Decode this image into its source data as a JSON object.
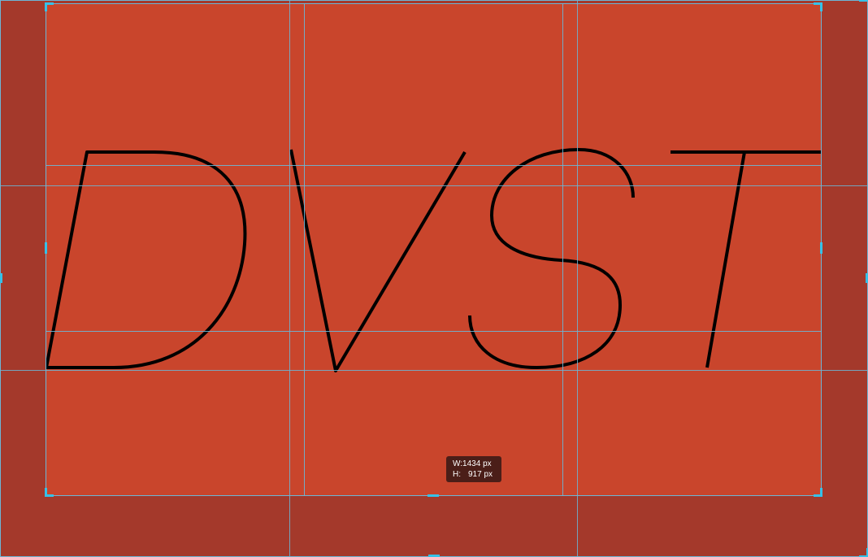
{
  "canvas": {
    "text": "DVST",
    "background_color": "#c9452c",
    "outside_color": "#a4392b",
    "guide_color": "#6cb6d6",
    "handle_color": "#35c1e8"
  },
  "tooltip": {
    "width_label": "W:",
    "width_value": "1434 px",
    "height_label": "H:",
    "height_value": "917 px"
  }
}
